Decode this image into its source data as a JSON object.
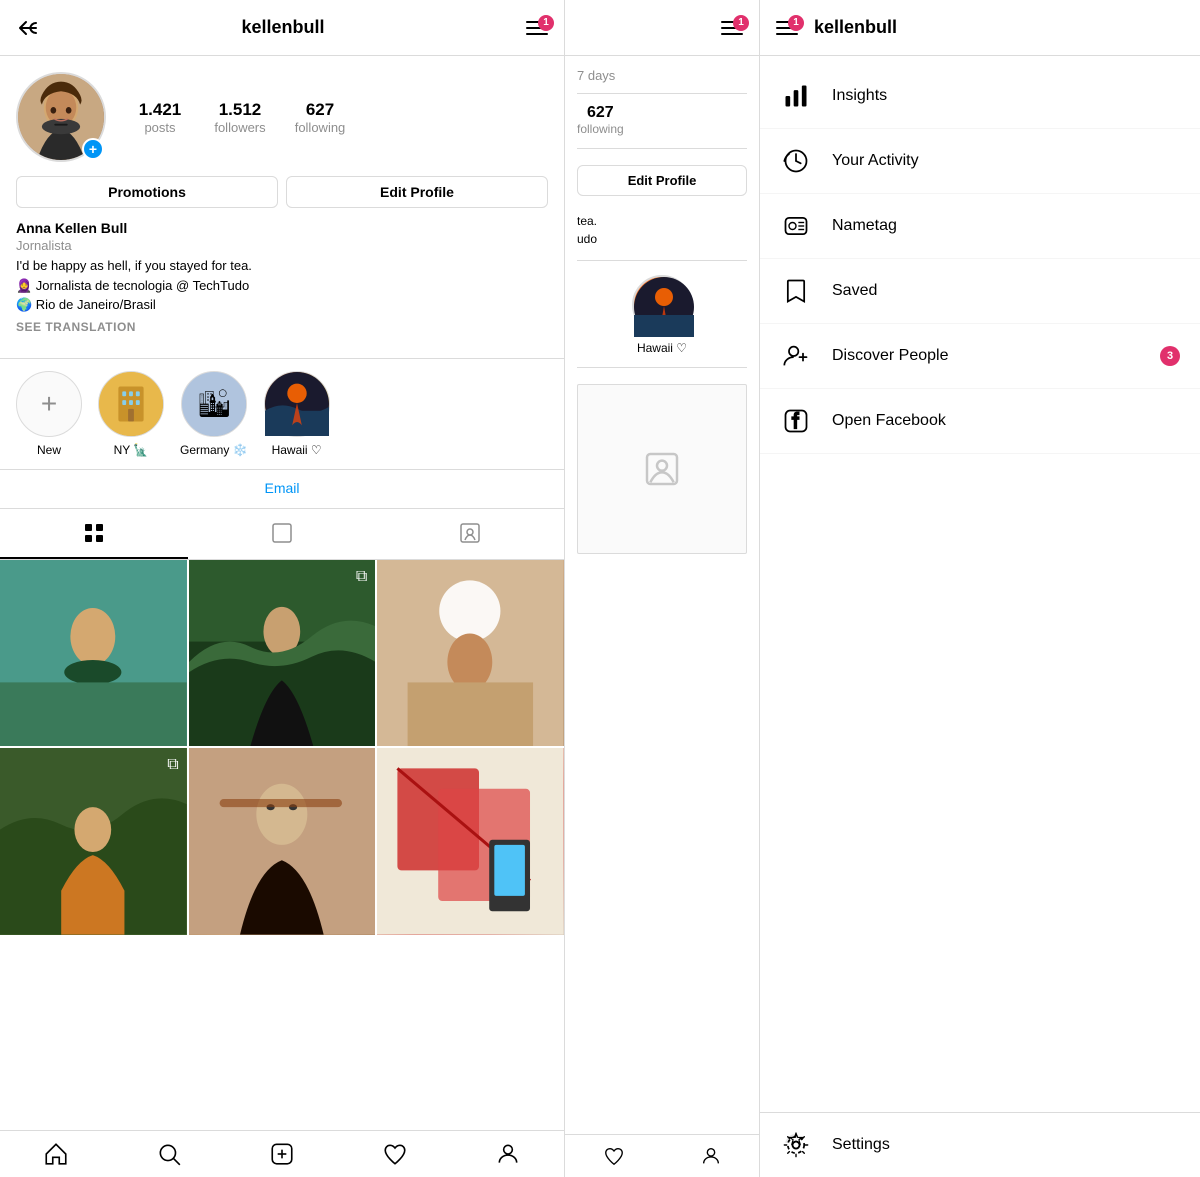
{
  "header": {
    "username": "kellenbull",
    "badge_count": "1",
    "back_icon": "↩"
  },
  "profile": {
    "name": "Anna Kellen Bull",
    "subtitle": "Jornalista",
    "bio_line1": "I'd be happy as hell, if you stayed for tea.",
    "bio_line2": "🧕 Jornalista de tecnologia @ TechTudo",
    "bio_line3": "🌍 Rio de Janeiro/Brasil",
    "see_translation": "SEE TRANSLATION",
    "posts_count": "1.421",
    "posts_label": "posts",
    "followers_count": "1.512",
    "followers_label": "followers",
    "following_count": "627",
    "following_label": "following",
    "promotions_btn": "Promotions",
    "edit_profile_btn": "Edit Profile",
    "email_link": "Email"
  },
  "stories": [
    {
      "label": "New",
      "type": "new"
    },
    {
      "label": "NY 🗽",
      "type": "ny"
    },
    {
      "label": "Germany ❄️",
      "type": "germany"
    },
    {
      "label": "Hawaii ♡",
      "type": "hawaii"
    }
  ],
  "tabs": [
    {
      "label": "grid",
      "active": true
    },
    {
      "label": "list",
      "active": false
    },
    {
      "label": "tagged",
      "active": false
    }
  ],
  "bottom_nav": [
    "home",
    "search",
    "add",
    "heart",
    "profile"
  ],
  "middle": {
    "days_label": "7 days",
    "following_count": "627",
    "following_label": "following",
    "edit_btn": "Edit Profile",
    "bio_partial1": "tea.",
    "bio_partial2": "udo",
    "story_label": "Hawaii ♡",
    "username": "kellenbull"
  },
  "right": {
    "username": "kellenbull",
    "badge_count": "1",
    "menu_items": [
      {
        "id": "insights",
        "label": "Insights",
        "icon": "bar_chart"
      },
      {
        "id": "your_activity",
        "label": "Your Activity",
        "icon": "activity"
      },
      {
        "id": "nametag",
        "label": "Nametag",
        "icon": "nametag"
      },
      {
        "id": "saved",
        "label": "Saved",
        "icon": "bookmark"
      },
      {
        "id": "discover_people",
        "label": "Discover People",
        "icon": "add_person",
        "badge": "3"
      },
      {
        "id": "open_facebook",
        "label": "Open Facebook",
        "icon": "facebook"
      }
    ],
    "settings_label": "Settings",
    "discover_badge": "3"
  }
}
